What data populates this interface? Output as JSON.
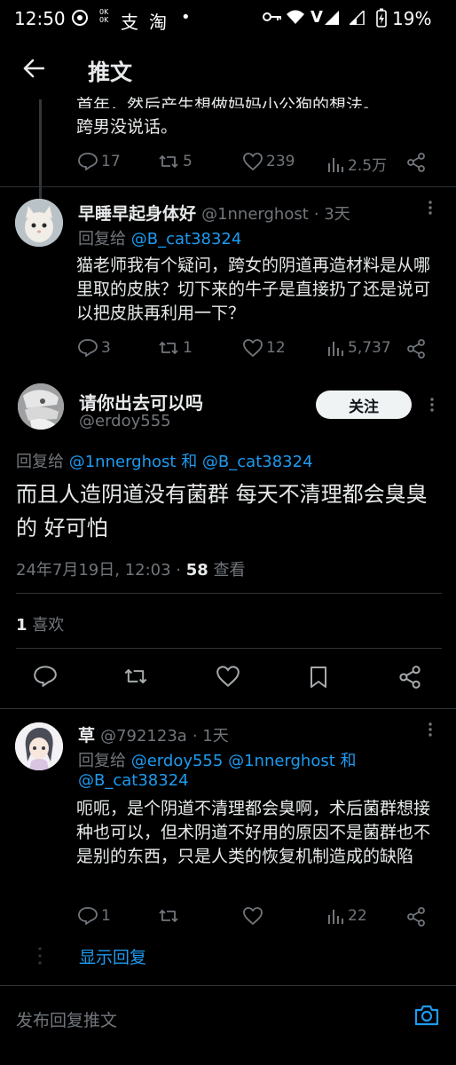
{
  "status_bar": {
    "time": "12:50",
    "battery": "19%",
    "small_icons": [
      "0K\n0K"
    ]
  },
  "header": {
    "title": "推文"
  },
  "tweet_top": {
    "partial_text": "首年，然后产生想做妈妈小公狗的想法。",
    "last_line": "跨男没说话。",
    "stats": {
      "replies": "17",
      "retweets": "5",
      "likes": "239",
      "views": "2.5万"
    }
  },
  "reply1": {
    "name": "早睡早起身体好",
    "handle": "@1nnerghost",
    "time": "· 3天",
    "reply_to_prefix": "回复给",
    "reply_to": "@B_cat38324",
    "text": "猫老师我有个疑问，跨女的阴道再造材料是从哪里取的皮肤？切下来的牛子是直接扔了还是说可以把皮肤再利用一下？",
    "stats": {
      "replies": "3",
      "retweets": "1",
      "likes": "12",
      "views": "5,737"
    }
  },
  "main": {
    "name": "请你出去可以吗",
    "handle": "@erdoy555",
    "follow_label": "关注",
    "reply_to_prefix": "回复给",
    "reply_to_a": "@1nnerghost",
    "reply_to_and": "和",
    "reply_to_b": "@B_cat38324",
    "text": "而且人造阴道没有菌群 每天不清理都会臭臭的 好可怕",
    "timestamp": "24年7月19日, 12:03 · ",
    "views_count": "58",
    "views_label": " 查看",
    "likes_count": "1",
    "likes_label": " 喜欢"
  },
  "reply2": {
    "name": "草",
    "handle": "@792123a",
    "time": "· 1天",
    "reply_to_prefix": "回复给",
    "reply_to_a": "@erdoy555",
    "reply_to_b": "@1nnerghost",
    "reply_to_and": "和",
    "reply_to_c": "@B_cat38324",
    "text": "呃呃，是个阴道不清理都会臭啊，术后菌群想接种也可以，但术阴道不好用的原因不是菌群也不是别的东西，只是人类的恢复机制造成的缺陷",
    "stats": {
      "replies": "1",
      "retweets": "",
      "likes": "",
      "views": "22"
    },
    "show_replies": "显示回复"
  },
  "composer": {
    "placeholder": "发布回复推文"
  },
  "colors": {
    "accent": "#1d9bf0",
    "muted": "#71767b",
    "divider": "#2f3336"
  }
}
